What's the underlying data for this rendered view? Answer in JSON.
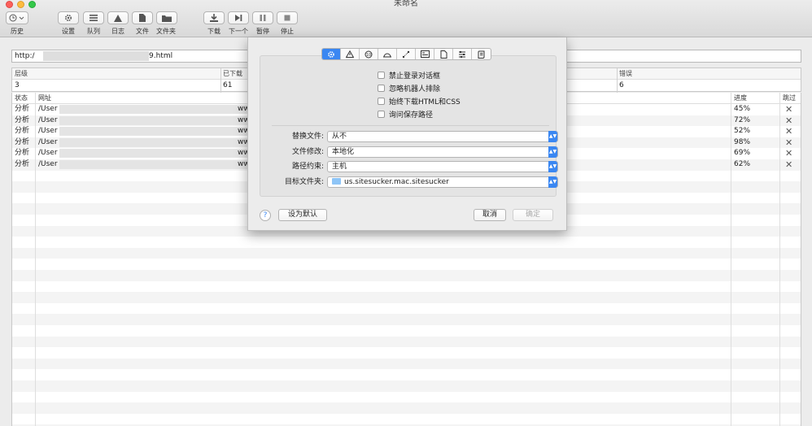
{
  "window": {
    "title": "未命名"
  },
  "toolbar": {
    "history": "历史",
    "settings": "设置",
    "queue": "队列",
    "log": "日志",
    "file": "文件",
    "folder": "文件夹",
    "download": "下载",
    "next": "下一个",
    "pause": "暂停",
    "stop": "停止"
  },
  "url": {
    "start": "http:/",
    "end": "9.html"
  },
  "stats": {
    "headers": [
      "层级",
      "已下载",
      "错误"
    ],
    "values": [
      "3",
      "61",
      "6"
    ]
  },
  "table": {
    "headers": {
      "status": "状态",
      "url": "网址",
      "progress": "进度",
      "skip": "跳过"
    },
    "rows": [
      {
        "status": "分析",
        "url": "/User",
        "url2": "ww",
        "progress": "45%"
      },
      {
        "status": "分析",
        "url": "/User",
        "url2": "ww",
        "progress": "72%"
      },
      {
        "status": "分析",
        "url": "/User",
        "url2": "ww",
        "progress": "52%"
      },
      {
        "status": "分析",
        "url": "/User",
        "url2": "ww",
        "progress": "98%"
      },
      {
        "status": "分析",
        "url": "/User",
        "url2": "ww",
        "progress": "69%"
      },
      {
        "status": "分析",
        "url": "/User",
        "url2": "ww",
        "progress": "62%"
      }
    ]
  },
  "dialog": {
    "tabs": [
      "gear-icon",
      "warning-icon",
      "limit-icon",
      "network-icon",
      "path-icon",
      "form-icon",
      "file-icon",
      "sliders-icon",
      "script-icon"
    ],
    "checkboxes": [
      "禁止登录对话框",
      "忽略机器人排除",
      "始终下载HTML和CSS",
      "询问保存路径"
    ],
    "fields": [
      {
        "label": "替换文件:",
        "value": "从不"
      },
      {
        "label": "文件修改:",
        "value": "本地化"
      },
      {
        "label": "路径约束:",
        "value": "主机"
      },
      {
        "label": "目标文件夹:",
        "value": "us.sitesucker.mac.sitesucker"
      }
    ],
    "help": "?",
    "set_default": "设为默认",
    "cancel": "取消",
    "ok": "确定"
  }
}
